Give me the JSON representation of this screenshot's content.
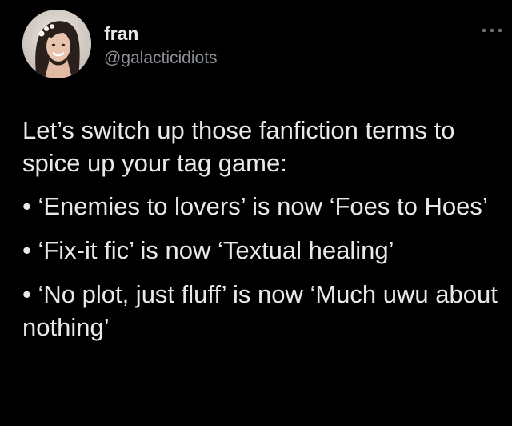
{
  "author": {
    "display_name": "fran",
    "handle": "@galacticidiots"
  },
  "more_icon": "more-dots-icon",
  "tweet": {
    "intro": "Let’s switch up those fanfiction terms to spice up your tag game:",
    "bullets": [
      "• ‘Enemies to lovers’ is now ‘Foes to Hoes’",
      "• ‘Fix-it fic’ is now ‘Textual healing’",
      "• ‘No plot, just fluff’ is now ‘Much uwu about nothing’"
    ]
  },
  "colors": {
    "background": "#000000",
    "text": "#e7e9ea",
    "secondary_text": "#8b9096"
  }
}
